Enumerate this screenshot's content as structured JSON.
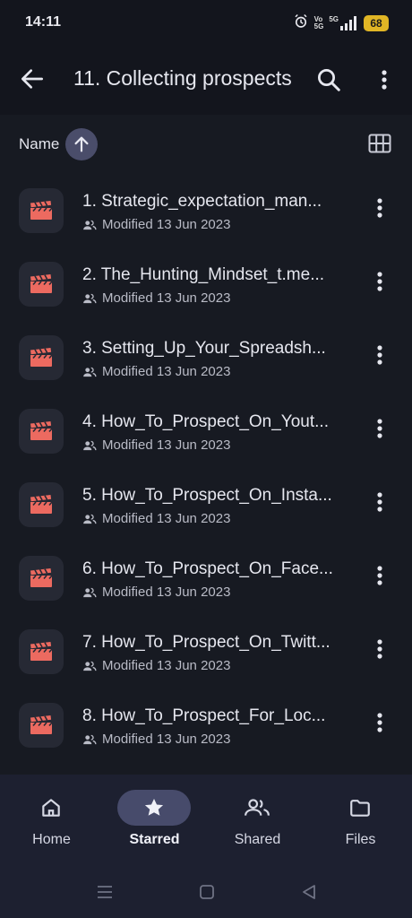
{
  "status_bar": {
    "time": "14:11",
    "battery": "68",
    "network_label": "5G",
    "volte_top": "Vo",
    "volte_bottom": "5G"
  },
  "app_bar": {
    "title": "11. Collecting prospects",
    "icons": [
      "back-arrow-icon",
      "search-icon",
      "more-vert-icon"
    ]
  },
  "sort": {
    "label": "Name",
    "direction": "ascending",
    "view_icon": "grid-view-icon"
  },
  "files": [
    {
      "name": "1. Strategic_expectation_man...",
      "meta": "Modified 13 Jun 2023"
    },
    {
      "name": "2. The_Hunting_Mindset_t.me...",
      "meta": "Modified 13 Jun 2023"
    },
    {
      "name": "3. Setting_Up_Your_Spreadsh...",
      "meta": "Modified 13 Jun 2023"
    },
    {
      "name": "4. How_To_Prospect_On_Yout...",
      "meta": "Modified 13 Jun 2023"
    },
    {
      "name": "5. How_To_Prospect_On_Insta...",
      "meta": "Modified 13 Jun 2023"
    },
    {
      "name": "6. How_To_Prospect_On_Face...",
      "meta": "Modified 13 Jun 2023"
    },
    {
      "name": "7. How_To_Prospect_On_Twitt...",
      "meta": "Modified 13 Jun 2023"
    },
    {
      "name": "8. How_To_Prospect_For_Loc...",
      "meta": "Modified 13 Jun 2023"
    }
  ],
  "bottom_nav": [
    {
      "label": "Home",
      "icon": "home-icon",
      "active": false
    },
    {
      "label": "Starred",
      "icon": "star-icon",
      "active": true
    },
    {
      "label": "Shared",
      "icon": "shared-people-icon",
      "active": false
    },
    {
      "label": "Files",
      "icon": "folder-icon",
      "active": false
    }
  ],
  "colors": {
    "background": "#13151d",
    "surface": "#171a22",
    "video_icon": "#ec6a60",
    "accent_pill": "#474b6b",
    "sort_button": "#4a4d6a",
    "battery": "#e0b525"
  }
}
